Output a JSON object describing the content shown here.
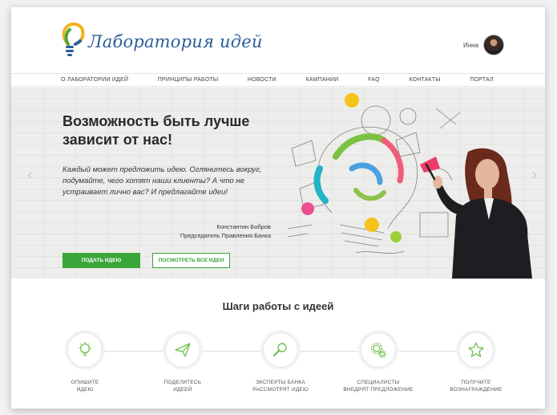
{
  "header": {
    "logo_text": "Лаборатория идей",
    "user_name": "Инна"
  },
  "nav": {
    "items": [
      "О ЛАБОРАТОРИИ ИДЕЙ",
      "ПРИНЦИПЫ РАБОТЫ",
      "НОВОСТИ",
      "КАМПАНИИ",
      "FAQ",
      "КОНТАКТЫ",
      "ПОРТАЛ"
    ]
  },
  "hero": {
    "title_line1": "Возможность быть лучше",
    "title_line2": "зависит от нас!",
    "text": "Каждый может предложить идею. Оглянитесь вокруг, подумайте, чего хотят наши клиенты? А что не устраивает лично вас? И предлагайте идеи!",
    "author_name": "Константин Бобров",
    "author_title": "Председатель Правления Банка",
    "primary_button": "ПОДАТЬ ИДЕЮ",
    "secondary_button": "ПОСМОТРЕТЬ ВСЕ ИДЕИ",
    "prev_arrow": "‹",
    "next_arrow": "›"
  },
  "steps": {
    "title": "Шаги работы с идеей",
    "items": [
      {
        "line1": "ОПИШИТЕ",
        "line2": "ИДЕЮ",
        "icon": "lightbulb-icon"
      },
      {
        "line1": "ПОДЕЛИТЕСЬ",
        "line2": "ИДЕЕЙ",
        "icon": "paper-plane-icon"
      },
      {
        "line1": "ЭКСПЕРТЫ БАНКА",
        "line2": "РАССМОТРЯТ ИДЕЮ",
        "icon": "magnifier-icon"
      },
      {
        "line1": "СПЕЦИАЛИСТЫ",
        "line2": "ВНЕДРЯТ ПРЕДЛОЖЕНИЕ",
        "icon": "gears-icon"
      },
      {
        "line1": "ПОЛУЧИТЕ",
        "line2": "ВОЗНАГРАЖДЕНИЕ",
        "icon": "star-icon"
      }
    ]
  },
  "colors": {
    "brand_blue": "#2b5d99",
    "accent_green": "#3aa63a",
    "step_icon_green": "#6cbf4a"
  }
}
